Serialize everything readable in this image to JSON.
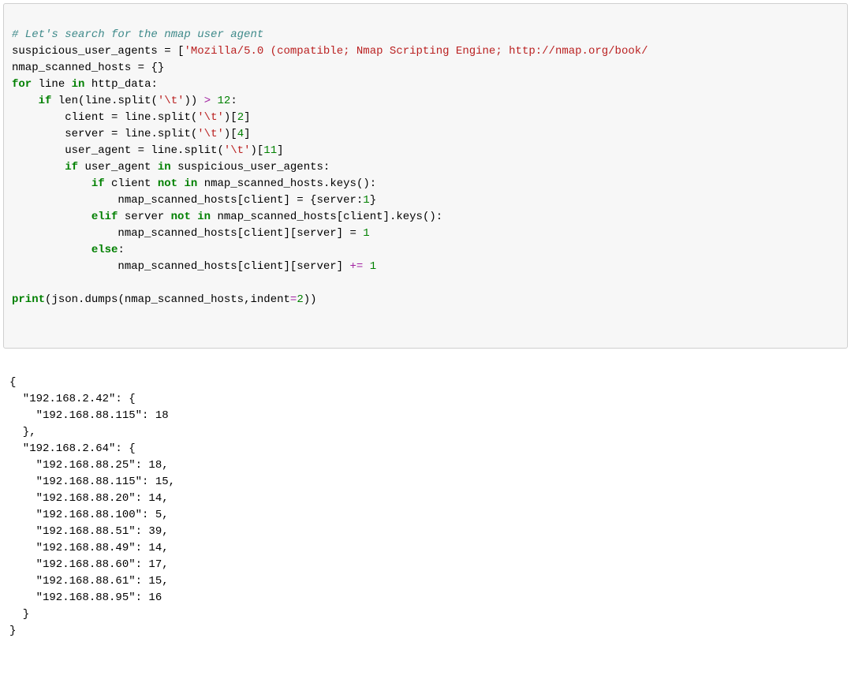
{
  "code": {
    "comment": "# Let's search for the nmap user agent",
    "var_sus": "suspicious_user_agents",
    "eq": " = ",
    "sus_list_open": "[",
    "sus_list_item": "'Mozilla/5.0 (compatible; Nmap Scripting Engine; http://nmap.org/book/",
    "var_nmap": "nmap_scanned_hosts",
    "empty_dict": " = {}",
    "kw_for": "for",
    "sp": " ",
    "id_line": "line",
    "kw_in": "in",
    "id_http": "http_data:",
    "indent1": "    ",
    "indent2": "        ",
    "indent3": "            ",
    "indent4": "                ",
    "kw_if": "if",
    "fn_len": "len",
    "paren_o": "(",
    "paren_c": ")",
    "dot": ".",
    "fn_split": "split",
    "str_tab": "'\\t'",
    "gt": " > ",
    "n12": "12",
    "colon": ":",
    "assign_client": "client = line",
    "idx2": "[",
    "n2": "2",
    "close_idx": "]",
    "assign_server": "server = line",
    "n4": "4",
    "assign_ua": "user_agent = line",
    "n11": "11",
    "cond_ua": "user_agent ",
    "id_sus": "suspicious_user_agents:",
    "cond_client": "client ",
    "kw_not": "not",
    "id_keys": "nmap_scanned_hosts",
    "keys_call": ".keys():",
    "set_dict": "nmap_scanned_hosts[client] = {server:",
    "n1": "1",
    "close_brace": "}",
    "kw_elif": "elif",
    "cond_server": "server ",
    "nsh_client": "nmap_scanned_hosts[client]",
    "set_one_idx": "nmap_scanned_hosts[client][server] = ",
    "kw_else": "else",
    "plus_eq": " += ",
    "inc_target": "nmap_scanned_hosts[client][server]",
    "blank": "",
    "fn_print": "print",
    "json_dumps": "json",
    "dumps": "dumps",
    "args_nsh": "nmap_scanned_hosts,indent",
    "eq2": "=",
    "n2b": "2"
  },
  "output": {
    "l01": "{",
    "l02": "  \"192.168.2.42\": {",
    "l03": "    \"192.168.88.115\": 18",
    "l04": "  },",
    "l05": "  \"192.168.2.64\": {",
    "l06": "    \"192.168.88.25\": 18,",
    "l07": "    \"192.168.88.115\": 15,",
    "l08": "    \"192.168.88.20\": 14,",
    "l09": "    \"192.168.88.100\": 5,",
    "l10": "    \"192.168.88.51\": 39,",
    "l11": "    \"192.168.88.49\": 14,",
    "l12": "    \"192.168.88.60\": 17,",
    "l13": "    \"192.168.88.61\": 15,",
    "l14": "    \"192.168.88.95\": 16",
    "l15": "  }",
    "l16": "}"
  }
}
